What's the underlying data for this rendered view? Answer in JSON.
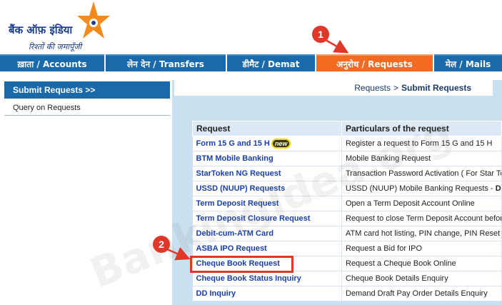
{
  "logo": {
    "bank_name": "बैंक ऑफ़ इंडिया",
    "tagline": "रिश्तों की जमापूँजी",
    "icon": "star-logo-icon"
  },
  "nav": {
    "tabs": [
      {
        "label": "ख़ाता / Accounts",
        "active": false
      },
      {
        "label": "लेन देन / Transfers",
        "active": false
      },
      {
        "label": "डीमैट / Demat",
        "active": false
      },
      {
        "label": "अनुरोध / Requests",
        "active": true
      },
      {
        "label": "मेल / Mails",
        "active": false
      }
    ]
  },
  "sidebar": {
    "items": [
      {
        "label": "Submit Requests >>",
        "active": true
      },
      {
        "label": "Query on Requests",
        "active": false
      }
    ]
  },
  "breadcrumb": {
    "parent": "Requests",
    "separator": ">",
    "current": "Submit Requests"
  },
  "table": {
    "headers": [
      "Request",
      "Particulars of the request"
    ],
    "rows": [
      {
        "request": "Form 15 G and 15 H",
        "badge": "new",
        "particulars": "Register a request to Form 15 G and 15 H"
      },
      {
        "request": "BTM Mobile Banking",
        "particulars": "Mobile Banking Request"
      },
      {
        "request": "StarToken NG Request",
        "particulars": "Transaction Password Activation ( For Star To"
      },
      {
        "request": "USSD (NUUP) Requests",
        "particulars": "USSD (NUUP) Mobile Banking Requests - ",
        "particulars_bold": "Does"
      },
      {
        "request": "Term Deposit Request",
        "particulars": "Open a Term Deposit Account Online"
      },
      {
        "request": "Term Deposit Closure Request",
        "particulars": "Request to close Term Deposit Account before"
      },
      {
        "request": "Debit-cum-ATM Card",
        "particulars": "ATM card hot listing, PIN change, PIN Reset a"
      },
      {
        "request": "ASBA IPO Request",
        "particulars": "Request a Bid for IPO"
      },
      {
        "request": "Cheque Book Request",
        "particulars": "Request a Cheque Book Online"
      },
      {
        "request": "Cheque Book Status Inquiry",
        "particulars": "Cheque Book Details Enquiry"
      },
      {
        "request": "DD Inquiry",
        "particulars": "Demand Draft Pay Order Details Enquiry"
      }
    ]
  },
  "watermark": "BankingIdea.org",
  "annotations": {
    "marker1": "1",
    "marker2": "2",
    "color": "#e0372a"
  },
  "colors": {
    "nav_blue": "#1a6aab",
    "nav_active": "#f26b21",
    "link_blue": "#1a3fa8",
    "content_bg": "#c9e0f1"
  }
}
